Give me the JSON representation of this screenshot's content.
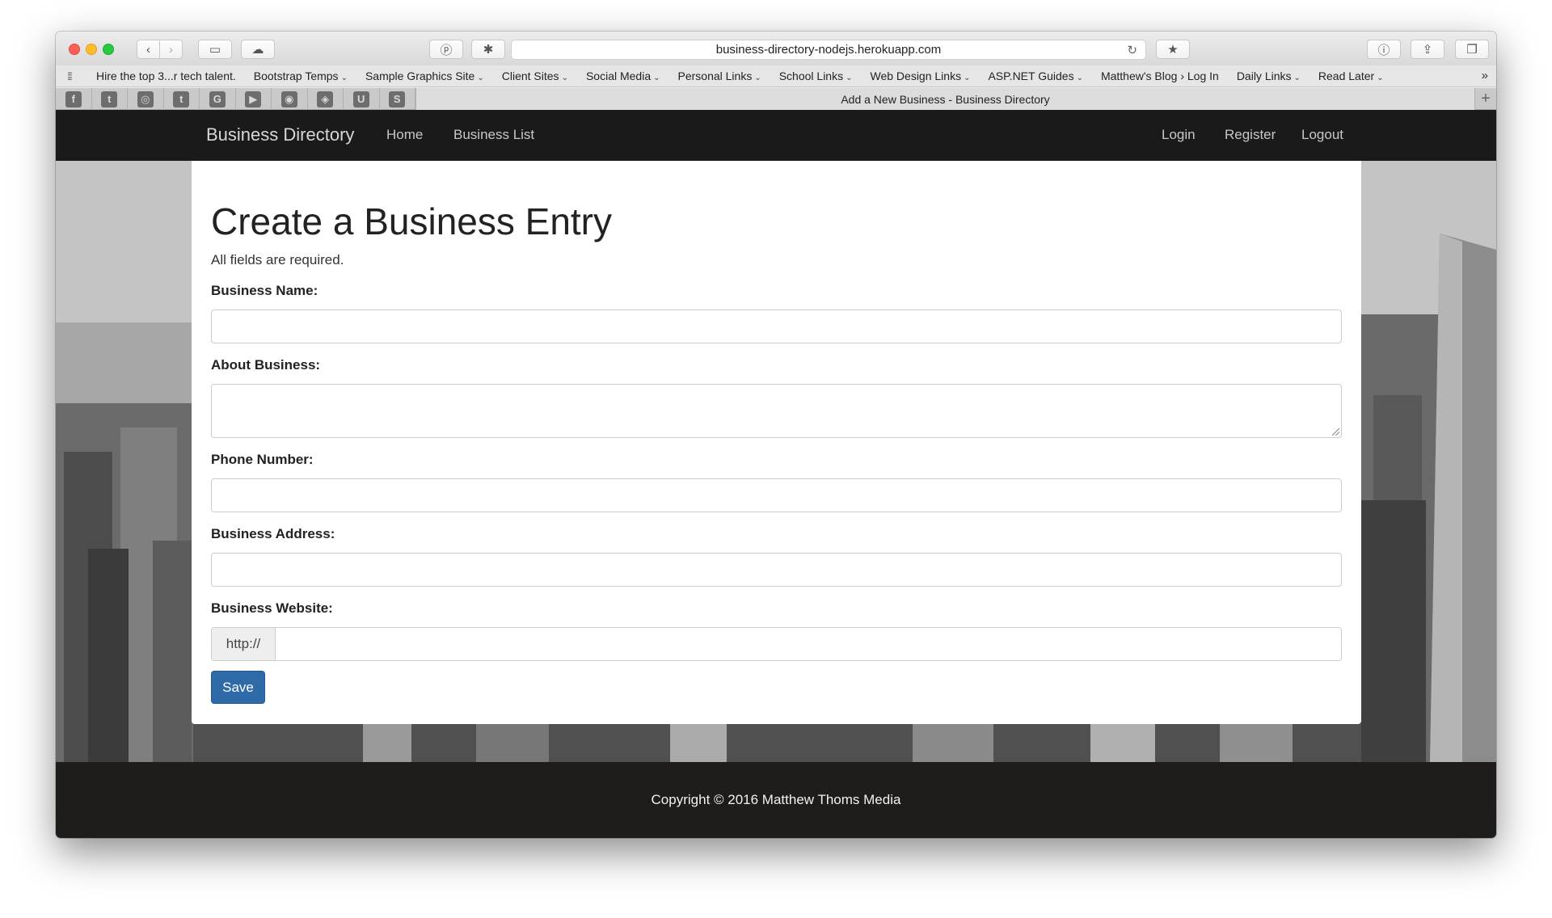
{
  "browser": {
    "url": "business-directory-nodejs.herokuapp.com",
    "tab_title": "Add a New Business - Business Directory",
    "bookmarks": [
      {
        "label": "Hire the top 3...r tech talent.",
        "menu": false
      },
      {
        "label": "Bootstrap Temps",
        "menu": true
      },
      {
        "label": "Sample Graphics Site",
        "menu": true
      },
      {
        "label": "Client Sites",
        "menu": true
      },
      {
        "label": "Social Media",
        "menu": true
      },
      {
        "label": "Personal Links",
        "menu": true
      },
      {
        "label": "School Links",
        "menu": true
      },
      {
        "label": "Web Design Links",
        "menu": true
      },
      {
        "label": "ASP.NET Guides",
        "menu": true
      },
      {
        "label": "Matthew's Blog › Log In",
        "menu": false
      },
      {
        "label": "Daily Links",
        "menu": true
      },
      {
        "label": "Read Later",
        "menu": true
      }
    ],
    "pinned_tabs": [
      "facebook-icon",
      "twitter-icon",
      "instagram-icon",
      "tumblr-icon",
      "google-icon",
      "youtube-icon",
      "github-icon",
      "codepen-icon",
      "udemy-icon",
      "stackoverflow-icon"
    ],
    "pinned_glyphs": [
      "f",
      "t",
      "◎",
      "t",
      "G",
      "▶",
      "◉",
      "◈",
      "U",
      "S"
    ]
  },
  "nav": {
    "brand": "Business Directory",
    "links": [
      "Home",
      "Business List"
    ],
    "right_links": [
      "Login",
      "Register",
      "Logout"
    ]
  },
  "form": {
    "title": "Create a Business Entry",
    "subtitle": "All fields are required.",
    "name_label": "Business Name:",
    "about_label": "About Business:",
    "phone_label": "Phone Number:",
    "address_label": "Business Address:",
    "website_label": "Business Website:",
    "website_prefix": "http://",
    "save_label": "Save"
  },
  "footer": {
    "copyright": "Copyright © 2016 Matthew Thoms Media"
  },
  "colors": {
    "navbar": "#1a1a1a",
    "footer": "#1e1d1b",
    "primary_button": "#2f6aa8"
  }
}
